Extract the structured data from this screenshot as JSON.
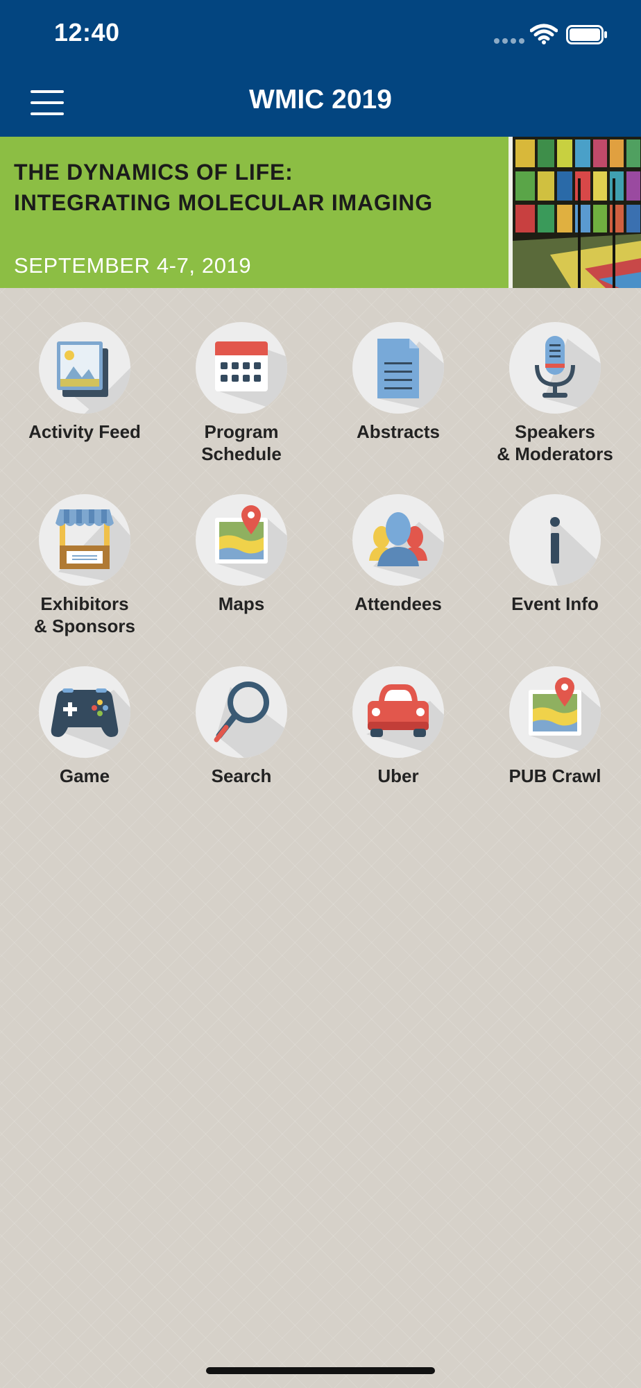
{
  "status_bar": {
    "time": "12:40"
  },
  "header": {
    "title": "WMIC 2019"
  },
  "banner": {
    "line1": "THE DYNAMICS OF LIFE:",
    "line2": "INTEGRATING MOLECULAR IMAGING",
    "dates": "SEPTEMBER 4-7, 2019"
  },
  "tiles": [
    {
      "label": "Activity Feed",
      "icon": "image-gallery-icon"
    },
    {
      "label": "Program\nSchedule",
      "icon": "calendar-icon"
    },
    {
      "label": "Abstracts",
      "icon": "document-icon"
    },
    {
      "label": "Speakers\n& Moderators",
      "icon": "microphone-icon"
    },
    {
      "label": "Exhibitors\n& Sponsors",
      "icon": "booth-icon"
    },
    {
      "label": "Maps",
      "icon": "map-pin-icon"
    },
    {
      "label": "Attendees",
      "icon": "people-icon"
    },
    {
      "label": "Event Info",
      "icon": "info-icon"
    },
    {
      "label": "Game",
      "icon": "gamepad-icon"
    },
    {
      "label": "Search",
      "icon": "magnifier-icon"
    },
    {
      "label": "Uber",
      "icon": "car-icon"
    },
    {
      "label": "PUB Crawl",
      "icon": "map-pin-icon"
    }
  ],
  "colors": {
    "header_bg": "#034580",
    "banner_green": "#8cbe44",
    "page_bg": "#d6d1c9"
  }
}
